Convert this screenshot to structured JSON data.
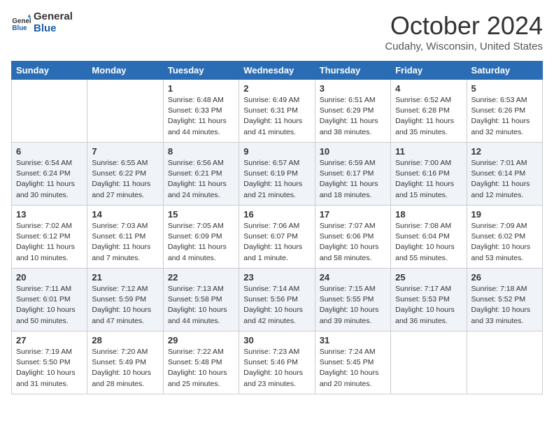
{
  "header": {
    "logo_line1": "General",
    "logo_line2": "Blue",
    "month": "October 2024",
    "location": "Cudahy, Wisconsin, United States"
  },
  "weekdays": [
    "Sunday",
    "Monday",
    "Tuesday",
    "Wednesday",
    "Thursday",
    "Friday",
    "Saturday"
  ],
  "weeks": [
    [
      {
        "day": "",
        "info": ""
      },
      {
        "day": "",
        "info": ""
      },
      {
        "day": "1",
        "info": "Sunrise: 6:48 AM\nSunset: 6:33 PM\nDaylight: 11 hours and 44 minutes."
      },
      {
        "day": "2",
        "info": "Sunrise: 6:49 AM\nSunset: 6:31 PM\nDaylight: 11 hours and 41 minutes."
      },
      {
        "day": "3",
        "info": "Sunrise: 6:51 AM\nSunset: 6:29 PM\nDaylight: 11 hours and 38 minutes."
      },
      {
        "day": "4",
        "info": "Sunrise: 6:52 AM\nSunset: 6:28 PM\nDaylight: 11 hours and 35 minutes."
      },
      {
        "day": "5",
        "info": "Sunrise: 6:53 AM\nSunset: 6:26 PM\nDaylight: 11 hours and 32 minutes."
      }
    ],
    [
      {
        "day": "6",
        "info": "Sunrise: 6:54 AM\nSunset: 6:24 PM\nDaylight: 11 hours and 30 minutes."
      },
      {
        "day": "7",
        "info": "Sunrise: 6:55 AM\nSunset: 6:22 PM\nDaylight: 11 hours and 27 minutes."
      },
      {
        "day": "8",
        "info": "Sunrise: 6:56 AM\nSunset: 6:21 PM\nDaylight: 11 hours and 24 minutes."
      },
      {
        "day": "9",
        "info": "Sunrise: 6:57 AM\nSunset: 6:19 PM\nDaylight: 11 hours and 21 minutes."
      },
      {
        "day": "10",
        "info": "Sunrise: 6:59 AM\nSunset: 6:17 PM\nDaylight: 11 hours and 18 minutes."
      },
      {
        "day": "11",
        "info": "Sunrise: 7:00 AM\nSunset: 6:16 PM\nDaylight: 11 hours and 15 minutes."
      },
      {
        "day": "12",
        "info": "Sunrise: 7:01 AM\nSunset: 6:14 PM\nDaylight: 11 hours and 12 minutes."
      }
    ],
    [
      {
        "day": "13",
        "info": "Sunrise: 7:02 AM\nSunset: 6:12 PM\nDaylight: 11 hours and 10 minutes."
      },
      {
        "day": "14",
        "info": "Sunrise: 7:03 AM\nSunset: 6:11 PM\nDaylight: 11 hours and 7 minutes."
      },
      {
        "day": "15",
        "info": "Sunrise: 7:05 AM\nSunset: 6:09 PM\nDaylight: 11 hours and 4 minutes."
      },
      {
        "day": "16",
        "info": "Sunrise: 7:06 AM\nSunset: 6:07 PM\nDaylight: 11 hours and 1 minute."
      },
      {
        "day": "17",
        "info": "Sunrise: 7:07 AM\nSunset: 6:06 PM\nDaylight: 10 hours and 58 minutes."
      },
      {
        "day": "18",
        "info": "Sunrise: 7:08 AM\nSunset: 6:04 PM\nDaylight: 10 hours and 55 minutes."
      },
      {
        "day": "19",
        "info": "Sunrise: 7:09 AM\nSunset: 6:02 PM\nDaylight: 10 hours and 53 minutes."
      }
    ],
    [
      {
        "day": "20",
        "info": "Sunrise: 7:11 AM\nSunset: 6:01 PM\nDaylight: 10 hours and 50 minutes."
      },
      {
        "day": "21",
        "info": "Sunrise: 7:12 AM\nSunset: 5:59 PM\nDaylight: 10 hours and 47 minutes."
      },
      {
        "day": "22",
        "info": "Sunrise: 7:13 AM\nSunset: 5:58 PM\nDaylight: 10 hours and 44 minutes."
      },
      {
        "day": "23",
        "info": "Sunrise: 7:14 AM\nSunset: 5:56 PM\nDaylight: 10 hours and 42 minutes."
      },
      {
        "day": "24",
        "info": "Sunrise: 7:15 AM\nSunset: 5:55 PM\nDaylight: 10 hours and 39 minutes."
      },
      {
        "day": "25",
        "info": "Sunrise: 7:17 AM\nSunset: 5:53 PM\nDaylight: 10 hours and 36 minutes."
      },
      {
        "day": "26",
        "info": "Sunrise: 7:18 AM\nSunset: 5:52 PM\nDaylight: 10 hours and 33 minutes."
      }
    ],
    [
      {
        "day": "27",
        "info": "Sunrise: 7:19 AM\nSunset: 5:50 PM\nDaylight: 10 hours and 31 minutes."
      },
      {
        "day": "28",
        "info": "Sunrise: 7:20 AM\nSunset: 5:49 PM\nDaylight: 10 hours and 28 minutes."
      },
      {
        "day": "29",
        "info": "Sunrise: 7:22 AM\nSunset: 5:48 PM\nDaylight: 10 hours and 25 minutes."
      },
      {
        "day": "30",
        "info": "Sunrise: 7:23 AM\nSunset: 5:46 PM\nDaylight: 10 hours and 23 minutes."
      },
      {
        "day": "31",
        "info": "Sunrise: 7:24 AM\nSunset: 5:45 PM\nDaylight: 10 hours and 20 minutes."
      },
      {
        "day": "",
        "info": ""
      },
      {
        "day": "",
        "info": ""
      }
    ]
  ]
}
